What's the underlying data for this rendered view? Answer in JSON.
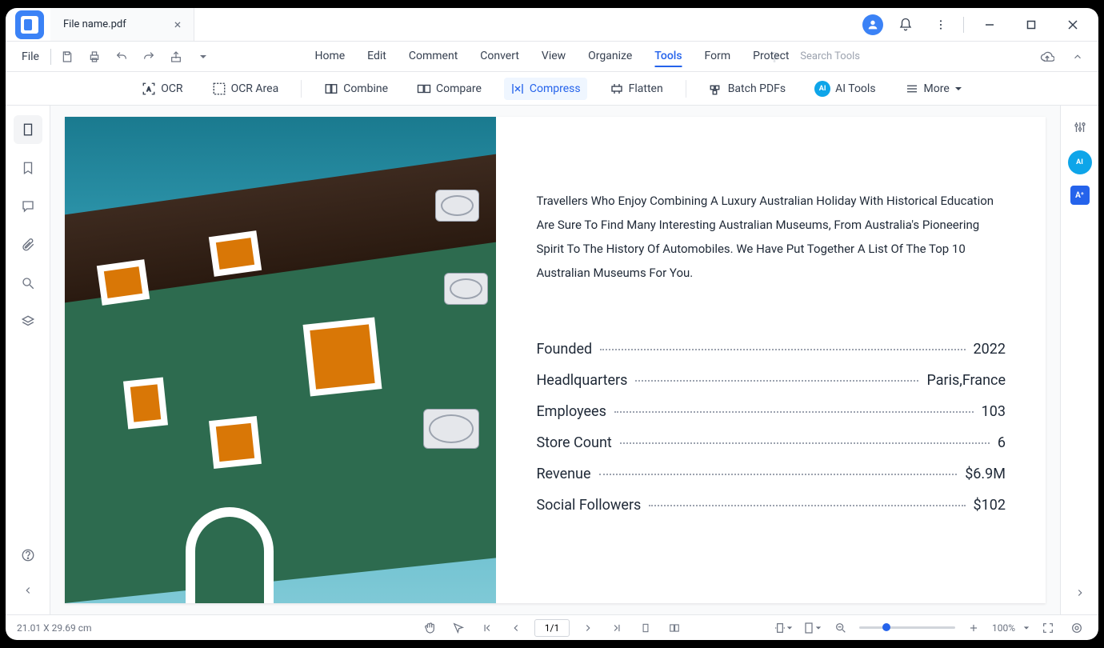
{
  "titlebar": {
    "tab_name": "File name.pdf"
  },
  "toolbar1": {
    "file_label": "File",
    "search_placeholder": "Search Tools"
  },
  "menu": {
    "items": [
      "Home",
      "Edit",
      "Comment",
      "Convert",
      "View",
      "Organize",
      "Tools",
      "Form",
      "Protect"
    ],
    "active_index": 6
  },
  "ribbon": {
    "ocr": "OCR",
    "ocr_area": "OCR Area",
    "combine": "Combine",
    "compare": "Compare",
    "compress": "Compress",
    "flatten": "Flatten",
    "batch": "Batch PDFs",
    "ai_tools": "AI Tools",
    "more": "More"
  },
  "document": {
    "paragraph": "Travellers Who Enjoy Combining A Luxury Australian Holiday With Historical Education Are Sure To Find Many Interesting Australian Museums, From Australia's Pioneering Spirit To The History Of Automobiles. We Have Put Together A List Of The Top 10 Australian Museums For You.",
    "stats": [
      {
        "label": "Founded",
        "value": "2022"
      },
      {
        "label": "Headlquarters",
        "value": "Paris,France"
      },
      {
        "label": "Employees",
        "value": "103"
      },
      {
        "label": "Store Count",
        "value": "6"
      },
      {
        "label": "Revenue",
        "value": "$6.9M"
      },
      {
        "label": "Social Followers",
        "value": "$102"
      }
    ]
  },
  "statusbar": {
    "dimensions": "21.01 X 29.69 cm",
    "page": "1/1",
    "zoom": "100%"
  }
}
